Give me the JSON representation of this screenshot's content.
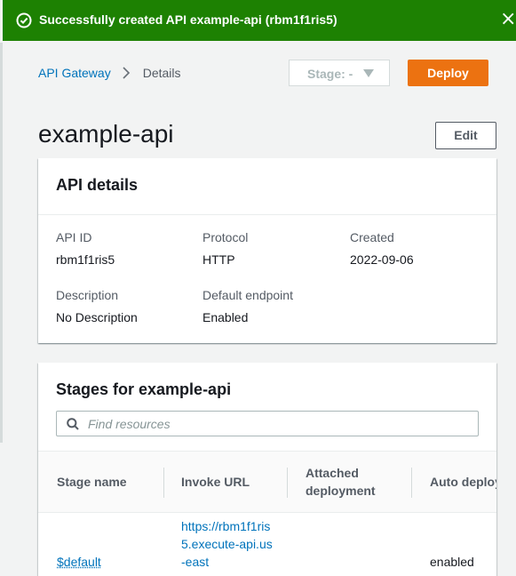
{
  "flash": {
    "message": "Successfully created API example-api (rbm1f1ris5)",
    "close_glyph": "×",
    "color": "#1d8102",
    "icon": "check-circle-icon"
  },
  "breadcrumb": {
    "root": "API Gateway",
    "current": "Details"
  },
  "stage_select": {
    "value": "Stage: -"
  },
  "deploy_label": "Deploy",
  "page_title": "example-api",
  "edit_label": "Edit",
  "api_details": {
    "title": "API details",
    "fields": {
      "api_id_label": "API ID",
      "api_id_value": "rbm1f1ris5",
      "protocol_label": "Protocol",
      "protocol_value": "HTTP",
      "created_label": "Created",
      "created_value": "2022-09-06",
      "description_label": "Description",
      "description_value": "No Description",
      "endpoint_label": "Default endpoint",
      "endpoint_value": "Enabled"
    }
  },
  "stages": {
    "title": "Stages for example-api",
    "search_placeholder": "Find resources",
    "columns": [
      "Stage name",
      "Invoke URL",
      "Attached deployment",
      "Auto deploy"
    ],
    "rows": [
      {
        "stage_name": "$default",
        "invoke_url": "https://rbm1f1ris5.execute-api.us-east",
        "attached_deployment": "",
        "auto_deploy": "enabled"
      }
    ]
  },
  "colors": {
    "accent": "#ec7211",
    "link": "#0073bb",
    "success": "#1d8102"
  }
}
